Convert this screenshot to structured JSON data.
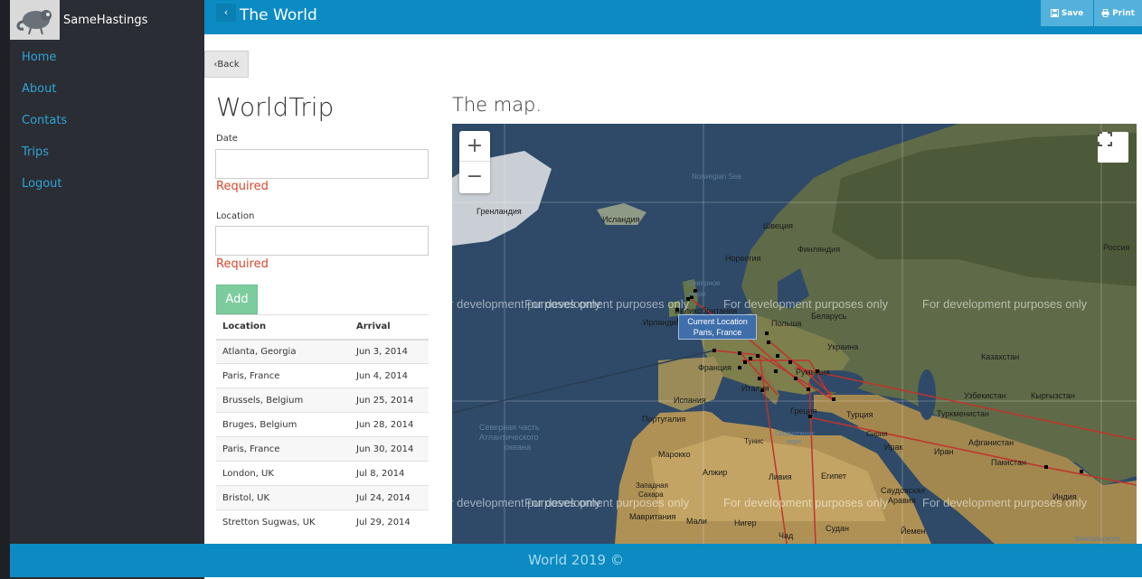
{
  "brand": {
    "name": "SameHastings",
    "logo_icon": "chameleon-logo-icon"
  },
  "sidebar": {
    "items": [
      {
        "label": "Home"
      },
      {
        "label": "About"
      },
      {
        "label": "Contats"
      },
      {
        "label": "Trips"
      },
      {
        "label": "Logout"
      }
    ]
  },
  "header": {
    "title": "The World",
    "back_icon": "chevron-left-icon",
    "save_label": "Save",
    "print_label": "Print"
  },
  "back_button": {
    "label": "‹Back"
  },
  "form": {
    "title": "WorldTrip",
    "date_label": "Date",
    "date_value": "",
    "date_error": "Required",
    "location_label": "Location",
    "location_value": "",
    "location_error": "Required",
    "add_label": "Add"
  },
  "table": {
    "headers": [
      "Location",
      "Arrival"
    ],
    "rows": [
      [
        "Atlanta, Georgia",
        "Jun 3, 2014"
      ],
      [
        "Paris, France",
        "Jun 4, 2014"
      ],
      [
        "Brussels, Belgium",
        "Jun 25, 2014"
      ],
      [
        "Bruges, Belgium",
        "Jun 28, 2014"
      ],
      [
        "Paris, France",
        "Jun 30, 2014"
      ],
      [
        "London, UK",
        "Jul 8, 2014"
      ],
      [
        "Bristol, UK",
        "Jul 24, 2014"
      ],
      [
        "Stretton Sugwas, UK",
        "Jul 29, 2014"
      ]
    ]
  },
  "map": {
    "heading": "The map.",
    "zoom_in": "+",
    "zoom_out": "−",
    "watermark": "For development purposes only",
    "current_location_title": "Current Location",
    "current_location_place": "Paris, France",
    "labels": {
      "greenland": "Гренландия",
      "iceland": "Исландия",
      "norwegian_sea": "Norwegian Sea",
      "sweden": "Швеция",
      "finland": "Финляндия",
      "norway": "Норвегия",
      "britain": "Великобритания",
      "ireland": "Ирландия",
      "poland": "Польша",
      "belarus": "Беларусь",
      "ukraine": "Украина",
      "kazakhstan": "Казахстан",
      "russia": "Россия",
      "france": "Франция",
      "romania": "Румыния",
      "italy": "Италия",
      "spain": "Испания",
      "portugal": "Португалия",
      "greece": "Греция",
      "turkey": "Турция",
      "uzbekistan": "Узбекистан",
      "kyrgyzstan": "Кыргызстан",
      "turkmenistan": "Туркменистан",
      "north_atlantic_1": "Северная часть",
      "north_atlantic_2": "Атлантического",
      "north_atlantic_3": "океана",
      "tunisia": "Тунис",
      "mediterranean_1": "Средиземное",
      "mediterranean_2": "море",
      "syria": "Сирия",
      "iraq": "Ирак",
      "iran": "Иран",
      "afghanistan": "Афганистан",
      "pakistan": "Пакистан",
      "morocco": "Марокко",
      "algeria": "Алжир",
      "libya": "Ливия",
      "egypt": "Египет",
      "western_sahara_1": "Западная",
      "western_sahara_2": "Сахара",
      "saudi_1": "Саудовская",
      "saudi_2": "Аравия",
      "mauritania": "Мавритания",
      "mali": "Мали",
      "niger": "Нигер",
      "sudan": "Судан",
      "chad": "Чад",
      "yemen": "Йемен",
      "india": "Индия",
      "bengal": "Бенгальского",
      "north_sea_1": "Северное",
      "north_sea_2": "море"
    }
  },
  "footer": {
    "text": "World 2019 ©"
  },
  "colors": {
    "sidebar": "#2a2d33",
    "header": "#0b8bc2",
    "link": "#2fa3d6",
    "error": "#d9472b",
    "add_button": "#7dcc9e",
    "route": "#c0332b"
  }
}
